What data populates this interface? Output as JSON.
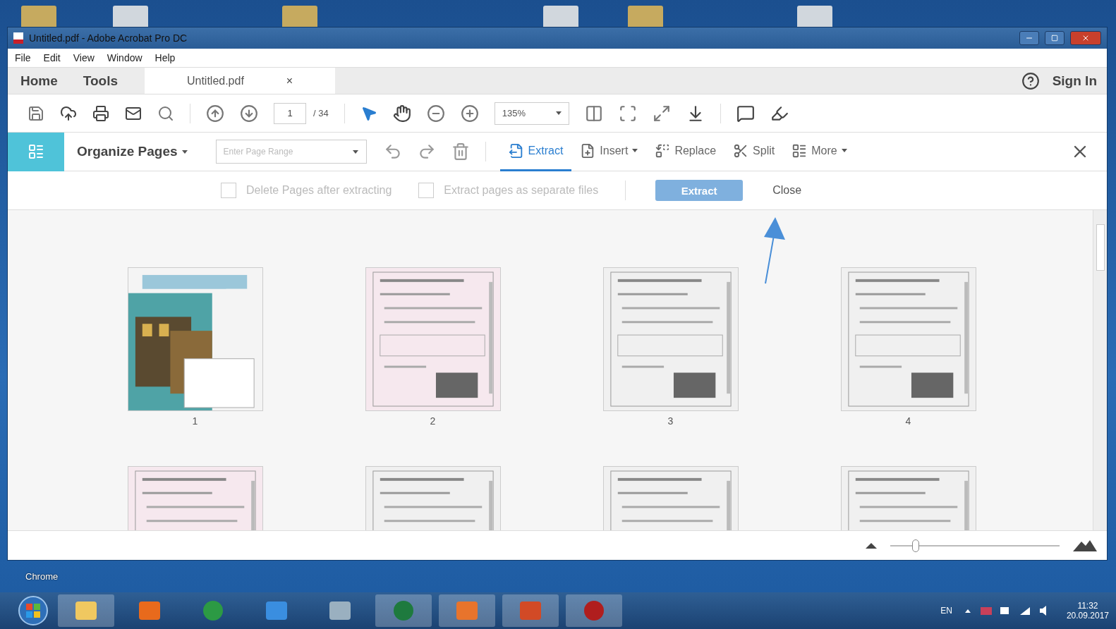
{
  "window": {
    "title": "Untitled.pdf - Adobe Acrobat Pro DC"
  },
  "menu": [
    "File",
    "Edit",
    "View",
    "Window",
    "Help"
  ],
  "tabs": [
    {
      "label": "Home",
      "selected": false
    },
    {
      "label": "Tools",
      "selected": false
    },
    {
      "label": "Untitled.pdf",
      "selected": true,
      "close": "×"
    }
  ],
  "sign_in": "Sign In",
  "toolbar": {
    "page_number": "1",
    "page_total": "/ 34",
    "zoom": "135%"
  },
  "organize": {
    "title": "Organize Pages",
    "range_placeholder": "Enter Page Range",
    "tools": [
      {
        "kind": "extract",
        "label": "Extract",
        "selected": true,
        "dropdown": false
      },
      {
        "kind": "insert",
        "label": "Insert",
        "selected": false,
        "dropdown": true
      },
      {
        "kind": "replace",
        "label": "Replace",
        "selected": false,
        "dropdown": false
      },
      {
        "kind": "split",
        "label": "Split",
        "selected": false,
        "dropdown": false
      },
      {
        "kind": "more",
        "label": "More",
        "selected": false,
        "dropdown": true
      }
    ]
  },
  "extract_options": {
    "options": [
      {
        "label": "Delete Pages after extracting",
        "checked": false
      },
      {
        "label": "Extract pages as separate files",
        "checked": false
      }
    ],
    "extract_button": "Extract",
    "close_button": "Close"
  },
  "pages": [
    {
      "kind": "cover",
      "label": "1"
    },
    {
      "kind": "pink",
      "label": "2"
    },
    {
      "kind": "grey",
      "label": "3"
    },
    {
      "kind": "grey",
      "label": "4"
    },
    {
      "kind": "pink"
    },
    {
      "kind": "grey"
    },
    {
      "kind": "grey"
    },
    {
      "kind": "grey"
    }
  ],
  "zoom_slider": {
    "level": 0.15
  },
  "desktop": {
    "icon_label": "Chrome"
  },
  "taskbar": {
    "language": "EN",
    "time": "11:32",
    "date": "20.09.2017"
  }
}
